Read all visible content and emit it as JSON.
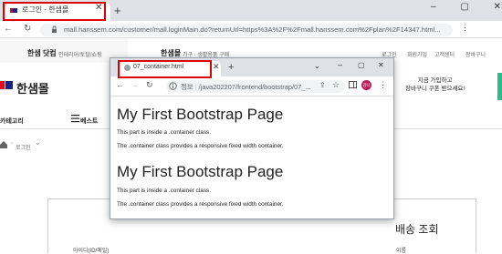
{
  "bg_browser": {
    "tab_title": "로그인 - 한샘몰",
    "url": "mall.hanssem.com/customer/mall.loginMain.do?returnUrl=https%3A%2F%2Fmall.hanssem.com%2Fplan%2F14347.html...",
    "win_controls": "– ▢ ✕"
  },
  "site": {
    "top_left_text": "한샘 닷컴",
    "top_left_sub": "인테리어/토탈/쇼핑",
    "top_center_logo": "한샘몰",
    "top_center_sub": "가구 · 생활용품 구매",
    "top_right_items": [
      "로그인",
      "회원가입",
      "고객센터",
      "장바구니"
    ],
    "logo_text": "한샘몰",
    "promo_line1": "지금 가입하고",
    "promo_line2": "장바구니 쿠폰 받으세요!",
    "category_menu": "카테고리",
    "best_menu": "베스트",
    "breadcrumb": "로그인",
    "delivery_title": "배송 조회",
    "login_id_label": "아이디(ID/메일)",
    "name_label": "이름"
  },
  "popup": {
    "tab_title": "07_container.html",
    "url": "/java202207/frontend/bootstrap/07_...",
    "info_label": "정보",
    "profile_initial": "감나",
    "sections": [
      {
        "heading": "My First Bootstrap Page",
        "line1": "This part is inside a .container class.",
        "line2": "The .container class provides a responsive fixed width container."
      },
      {
        "heading": "My First Bootstrap Page",
        "line1": "This part is inside a .container class.",
        "line2": "The .container class provides a responsive fixed width container."
      }
    ]
  },
  "colors": {
    "highlight": "#e00000",
    "accent_green": "#2dbd8c",
    "logo_red": "#e60012",
    "logo_navy": "#1a237e"
  }
}
